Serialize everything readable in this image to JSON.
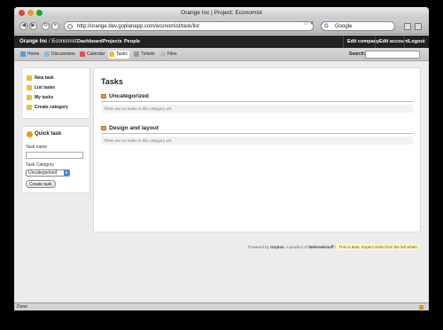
{
  "window": {
    "title": "Orange Inc | Project: Economist"
  },
  "browser": {
    "url": "http://orange.dev.goplanapp.com/economist/task/list",
    "search_engine": "Google",
    "search_placeholder": "Google",
    "status": "Done"
  },
  "appnav": {
    "brand": "Orange Inc",
    "project": "/ Economist",
    "items": [
      "Dashboard",
      "Projects",
      "People"
    ],
    "right_items": [
      "Edit company",
      "Edit account",
      "Logout"
    ]
  },
  "subnav": {
    "tabs": [
      {
        "label": "Home",
        "color": "#5b9bd5"
      },
      {
        "label": "Discussions",
        "color": "#8fb9e0"
      },
      {
        "label": "Calendar",
        "color": "#e05050"
      },
      {
        "label": "Tasks",
        "color": "#e6c238",
        "active": true
      },
      {
        "label": "Tickets",
        "color": "#9a9a9a"
      },
      {
        "label": "Files",
        "color": "#bbbbbb"
      }
    ],
    "search_label": "Search:"
  },
  "sidebar": {
    "items": [
      {
        "label": "New task",
        "color": "#e6c238"
      },
      {
        "label": "List tasks",
        "color": "#e6c238"
      },
      {
        "label": "My tasks",
        "color": "#e6c238"
      },
      {
        "label": "Create category",
        "color": "#e6c238"
      }
    ],
    "quick_task": {
      "title": "Quick task",
      "name_label": "Task name",
      "category_label": "Task Category",
      "category_value": "Uncategorized",
      "button": "Create task"
    }
  },
  "main": {
    "title": "Tasks",
    "categories": [
      {
        "name": "Uncategorized",
        "empty_text": "There are no tasks in this category yet."
      },
      {
        "name": "Design and layout",
        "empty_text": "There are no tasks in this category yet."
      }
    ]
  },
  "footer": {
    "powered_by": "Powered by",
    "app": "Goplan",
    "product_of": ", a product of",
    "company": "Webreakstuff",
    "separator": "/",
    "beta_note": "This is beta. Expect visits from the fail whale."
  }
}
